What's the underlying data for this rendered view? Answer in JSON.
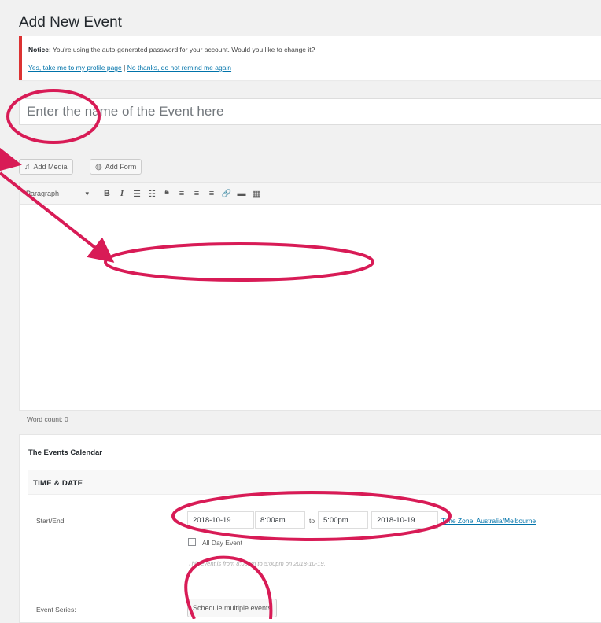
{
  "page": {
    "title": "Add New Event"
  },
  "notice": {
    "label": "Notice:",
    "message": "You're using the auto-generated password for your account. Would you like to change it?",
    "link_yes": "Yes, take me to my profile page",
    "separator": "|",
    "link_no": "No thanks, do not remind me again"
  },
  "title_input": {
    "placeholder": "Enter the name of the Event here"
  },
  "media_buttons": {
    "add_media": "Add Media",
    "add_media_icon": "camera-music-icon",
    "add_form": "Add Form",
    "add_form_icon": "gravity-forms-icon"
  },
  "toolbar": {
    "format": "Paragraph",
    "format_arrow": "▾",
    "bold": "B",
    "italic": "I",
    "bullet_list": "☰",
    "numbered_list": "☷",
    "blockquote": "❝",
    "align_left": "≡",
    "align_center": "≡",
    "align_right": "≡",
    "link": "🔗",
    "read_more": "▬",
    "toolbar_toggle": "▦"
  },
  "word_count": "Word count: 0",
  "events_calendar": {
    "title": "The Events Calendar",
    "section": "TIME & DATE",
    "start_end_label": "Start/End:",
    "start_date": "2018-10-19",
    "start_time": "8:00am",
    "to_label": "to",
    "end_time": "5:00pm",
    "end_date": "2018-10-19",
    "timezone_link": "Time Zone: Australia/Melbourne",
    "all_day_label": "All Day Event",
    "description": "This event is from 8:00am to 5:00pm on 2018-10-19.",
    "series_label": "Event Series:",
    "schedule_button": "Schedule multiple events"
  },
  "annotation": {
    "color": "#d81b56"
  }
}
